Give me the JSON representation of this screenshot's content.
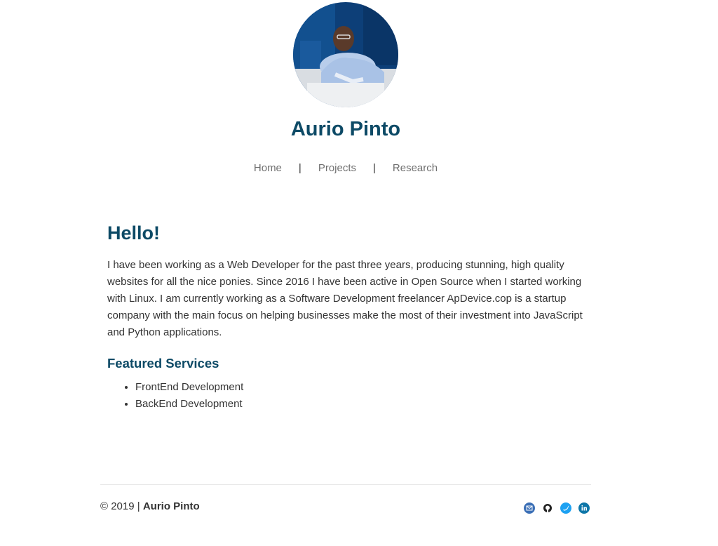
{
  "site": {
    "author_name": "Aurio Pinto"
  },
  "nav": {
    "items": [
      {
        "label": "Home"
      },
      {
        "label": "Projects"
      },
      {
        "label": "Research"
      }
    ],
    "separator": "|"
  },
  "main": {
    "heading": "Hello!",
    "intro": "I have been working as a Web Developer for the past three years, producing stunning, high quality websites for all the nice ponies. Since 2016 I have been active in Open Source when I started working with Linux. I am currently working as a Software Development freelancer ApDevice.cop is a startup company with the main focus on helping businesses make the most of their investment into JavaScript and Python applications.",
    "services_heading": "Featured Services",
    "services": [
      "FrontEnd Development",
      "BackEnd Development"
    ]
  },
  "footer": {
    "copyright": "© 2019 | ",
    "author": "Aurio Pinto"
  },
  "social": {
    "icons": [
      "mail-icon",
      "github-icon",
      "twitter-icon",
      "linkedin-icon"
    ],
    "colors": {
      "mail": "#3b6fb6",
      "github": "#222222",
      "twitter": "#1da1f2",
      "linkedin": "#0e76a8"
    }
  },
  "colors": {
    "accent": "#0d4a66",
    "nav_text": "#6f6f6f",
    "body_text": "#333333"
  }
}
